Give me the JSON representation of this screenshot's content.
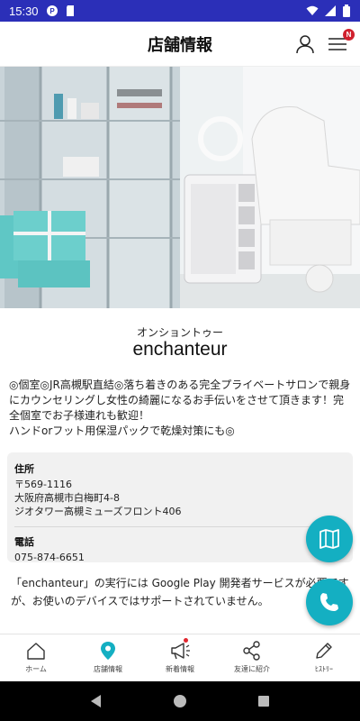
{
  "status_bar": {
    "time": "15:30"
  },
  "header": {
    "title": "店舗情報",
    "menu_badge": "N"
  },
  "shop": {
    "reading": "オンショントゥー",
    "name": "enchanteur",
    "description": "◎個室◎JR高槻駅直結◎落ち着きのある完全プライベートサロンで親身にカウンセリングし女性の綺麗になるお手伝いをさせて頂きます！完全個室でお子様連れも歓迎！\nハンドorフット用保湿パックで乾燥対策にも◎"
  },
  "info": {
    "address_label": "住所",
    "postal_code": "〒569-1116",
    "address_line1": "大阪府高槻市白梅町4-8",
    "address_line2": "ジオタワー高槻ミューズフロント406",
    "phone_label": "電話",
    "phone": "075-874-6651"
  },
  "notice": "「enchanteur」の実行には Google Play 開発者サービスが必要ですが、お使いのデバイスではサポートされていません。",
  "bottom_nav": [
    {
      "label": "ホーム",
      "icon": "home-icon"
    },
    {
      "label": "店舗情報",
      "icon": "location-pin-icon"
    },
    {
      "label": "新着情報",
      "icon": "megaphone-icon"
    },
    {
      "label": "友達に紹介",
      "icon": "share-icon"
    },
    {
      "label": "ﾋｽﾄﾘｰ",
      "icon": "pencil-icon"
    }
  ],
  "colors": {
    "accent": "#14afc2",
    "status_bar": "#2b2fb8",
    "badge": "#d0202d"
  }
}
